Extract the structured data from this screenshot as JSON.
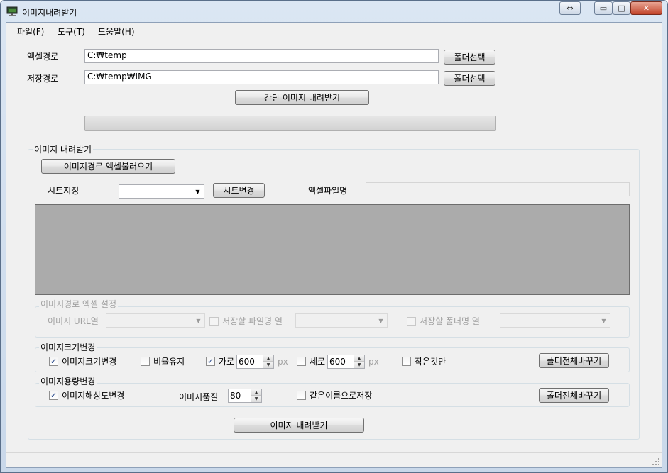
{
  "window": {
    "title": "이미지내려받기",
    "caption_buttons": {
      "restore_wide": "⇔",
      "minimize": "▭",
      "maximize": "□",
      "close": "✕"
    }
  },
  "menu": {
    "items": [
      "파일(F)",
      "도구(T)",
      "도움말(H)"
    ]
  },
  "paths": {
    "excel_label": "엑셀경로",
    "excel_value": "C:₩temp",
    "save_label": "저장경로",
    "save_value": "C:₩temp₩IMG",
    "folder_button": "폴더선택"
  },
  "simple_download_button": "간단 이미지 내려받기",
  "progress": {
    "value": 0
  },
  "download_group": {
    "title": "이미지 내려받기",
    "load_excel_button": "이미지경로 엑셀불러오기",
    "sheet_label": "시트지정",
    "sheet_value": "",
    "sheet_change_button": "시트변경",
    "excel_filename_label": "엑셀파일명",
    "excel_filename_value": ""
  },
  "excel_settings": {
    "title": "이미지경로 엑셀 설정",
    "url_col_label": "이미지 URL열",
    "filename_col_label": "저장할 파일명 열",
    "folder_col_label": "저장할 폴더명 열"
  },
  "resize": {
    "title": "이미지크기변경",
    "resize_check_label": "이미지크기변경",
    "resize_checked": true,
    "keep_ratio_label": "비율유지",
    "keep_ratio_checked": false,
    "width_label": "가로",
    "width_checked": true,
    "width_value": "600",
    "height_label": "세로",
    "height_checked": false,
    "height_value": "600",
    "px_unit": "px",
    "small_only_label": "작은것만",
    "small_only_checked": false,
    "folder_all_button": "폴더전체바꾸기"
  },
  "quality": {
    "title": "이미지용량변경",
    "resolution_label": "이미지해상도변경",
    "resolution_checked": true,
    "quality_label": "이미지품질",
    "quality_value": "80",
    "same_name_label": "같은이름으로저장",
    "same_name_checked": false,
    "folder_all_button": "폴더전체바꾸기"
  },
  "download_button": "이미지 내려받기",
  "colors": {
    "grid_bg": "#ababab",
    "check_mark": "#1c3f85",
    "title_bar": "#c9d8ea"
  }
}
